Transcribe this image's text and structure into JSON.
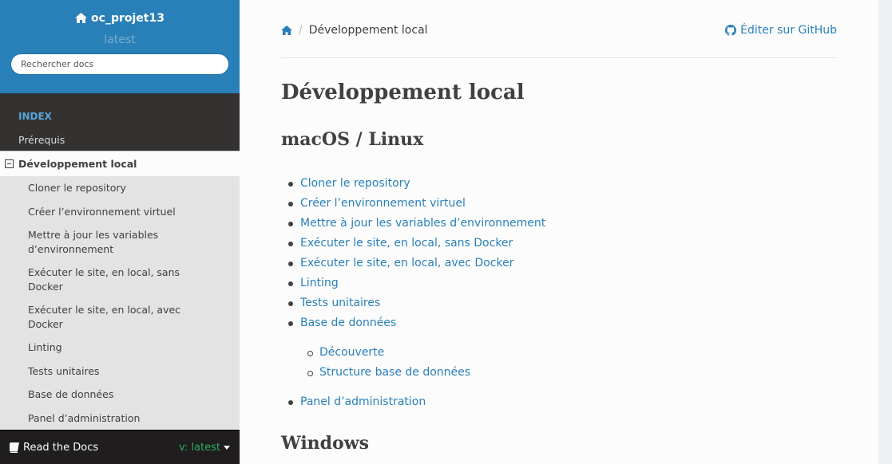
{
  "sidebar": {
    "project": "oc_projet13",
    "version": "latest",
    "search_placeholder": "Rechercher docs",
    "caption": "INDEX",
    "top_items": [
      {
        "label": "Prérequis"
      }
    ],
    "current": {
      "label": "Développement local",
      "children": [
        {
          "label": "Cloner le repository"
        },
        {
          "label": "Créer l’environnement virtuel"
        },
        {
          "label": "Mettre à jour les variables d’environnement"
        },
        {
          "label": "Exécuter le site, en local, sans Docker"
        },
        {
          "label": "Exécuter le site, en local, avec Docker"
        },
        {
          "label": "Linting"
        },
        {
          "label": "Tests unitaires"
        },
        {
          "label": "Base de données"
        },
        {
          "label": "Panel d’administration"
        }
      ]
    },
    "rtd_label": "Read the Docs",
    "rtd_version": "v: latest"
  },
  "breadcrumb": {
    "current": "Développement local",
    "edit_label": "Éditer sur GitHub"
  },
  "content": {
    "title": "Développement local",
    "section_mac": "macOS / Linux",
    "toc": [
      {
        "label": "Cloner le repository"
      },
      {
        "label": "Créer l’environnement virtuel"
      },
      {
        "label": "Mettre à jour les variables d’environnement"
      },
      {
        "label": "Exécuter le site, en local, sans Docker"
      },
      {
        "label": "Exécuter le site, en local, avec Docker"
      },
      {
        "label": "Linting"
      },
      {
        "label": "Tests unitaires"
      },
      {
        "label": "Base de données"
      }
    ],
    "subtoc": [
      {
        "label": "Découverte"
      },
      {
        "label": "Structure base de données"
      }
    ],
    "toc_last": {
      "label": "Panel d’administration"
    },
    "section_win": "Windows"
  },
  "colors": {
    "brand": "#2980b9",
    "sidebar_bg": "#343131",
    "link": "#2980b9",
    "version_green": "#27ae60"
  }
}
